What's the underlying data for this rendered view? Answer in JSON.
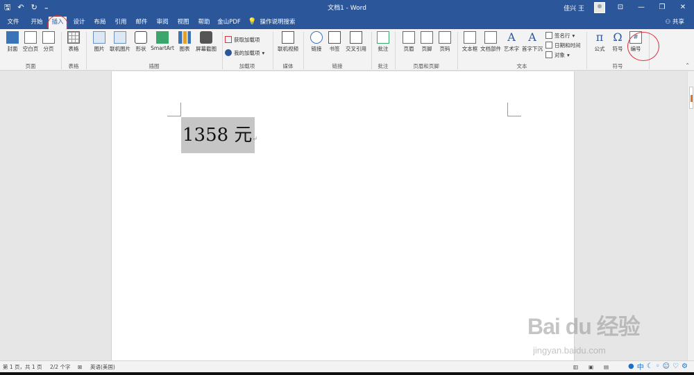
{
  "titlebar": {
    "doc_title": "文档1 - Word",
    "user_name": "佳兴 王",
    "qat_icons": [
      "save-icon",
      "undo-icon",
      "redo-icon",
      "customize-icon"
    ]
  },
  "tabs": [
    {
      "label": "文件"
    },
    {
      "label": "开始"
    },
    {
      "label": "插入"
    },
    {
      "label": "设计"
    },
    {
      "label": "布局"
    },
    {
      "label": "引用"
    },
    {
      "label": "邮件"
    },
    {
      "label": "审阅"
    },
    {
      "label": "视图"
    },
    {
      "label": "帮助"
    },
    {
      "label": "金山PDF"
    }
  ],
  "tell_me": "操作说明搜索",
  "share_label": "共享",
  "ribbon": {
    "page_group": {
      "label": "页面",
      "cover": "封面",
      "blank": "空白页",
      "break": "分页"
    },
    "table_group": {
      "label": "表格",
      "table": "表格"
    },
    "illus_group": {
      "label": "插图",
      "pictures": "图片",
      "online_pictures": "联机图片",
      "shapes": "形状",
      "smartart": "SmartArt",
      "chart": "图表",
      "screenshot": "屏幕截图"
    },
    "addins_group": {
      "label": "加载项",
      "get": "获取加载项",
      "mine": "我的加载项"
    },
    "media_group": {
      "label": "媒体",
      "online_video": "联机视频"
    },
    "links_group": {
      "label": "链接",
      "link": "链接",
      "bookmark": "书签",
      "cross_ref": "交叉引用"
    },
    "comment_group": {
      "label": "批注",
      "comment": "批注"
    },
    "hf_group": {
      "label": "页眉和页脚",
      "header": "页眉",
      "footer": "页脚",
      "page_no": "页码"
    },
    "text_group": {
      "label": "文本",
      "textbox": "文本框",
      "quick_parts": "文档部件",
      "wordart": "艺术字",
      "dropcap": "首字下沉",
      "signature": "签名行",
      "datetime": "日期和时间",
      "object": "对象"
    },
    "symbol_group": {
      "label": "符号",
      "equation": "公式",
      "symbol": "符号",
      "number": "编号",
      "pi_glyph": "π",
      "omega_glyph": "Ω"
    }
  },
  "document": {
    "content": "1358 元"
  },
  "statusbar": {
    "page": "第 1 页，共 1 页",
    "words": "2/2 个字",
    "lang": "英语(美国)"
  },
  "watermark": {
    "main": "Bai du 经验",
    "sub": "jingyan.baidu.com"
  },
  "ime": {
    "label": "中"
  }
}
